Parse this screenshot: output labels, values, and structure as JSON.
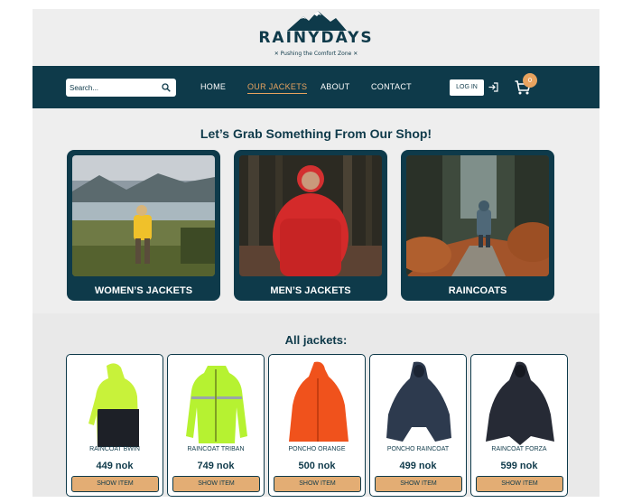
{
  "brand": {
    "name": "RAINYDAYS",
    "tagline": "✕ Pushing the Comfort Zone ✕",
    "logo": "mountain-logo"
  },
  "nav": {
    "search_placeholder": "Search...",
    "links": [
      "HOME",
      "OUR JACKETS",
      "ABOUT",
      "CONTACT"
    ],
    "active": "OUR JACKETS",
    "login_label": "LOG IN",
    "cart_count": "0"
  },
  "shop": {
    "title": "Let’s Grab Something From Our Shop!",
    "categories": [
      "WOMEN’S JACKETS",
      "MEN’S JACKETS",
      "RAINCOATS"
    ]
  },
  "jackets": {
    "title": "All jackets:",
    "button_label": "SHOW ITEM",
    "items": [
      {
        "name": "RAINCOAT BWIN",
        "price": "449 nok",
        "color": "#c8f23a"
      },
      {
        "name": "RAINCOAT TRIBAN",
        "price": "749 nok",
        "color": "#b6f231"
      },
      {
        "name": "PONCHO ORANGE",
        "price": "500 nok",
        "color": "#f0521c"
      },
      {
        "name": "PONCHO RAINCOAT",
        "price": "499 nok",
        "color": "#2d3a4e"
      },
      {
        "name": "RAINCOAT FORZA",
        "price": "599 nok",
        "color": "#262a35"
      }
    ]
  },
  "colors": {
    "primary": "#0e3a4a",
    "accent": "#e8a35f",
    "button": "#e3ad74",
    "background": "#eeeeee"
  }
}
